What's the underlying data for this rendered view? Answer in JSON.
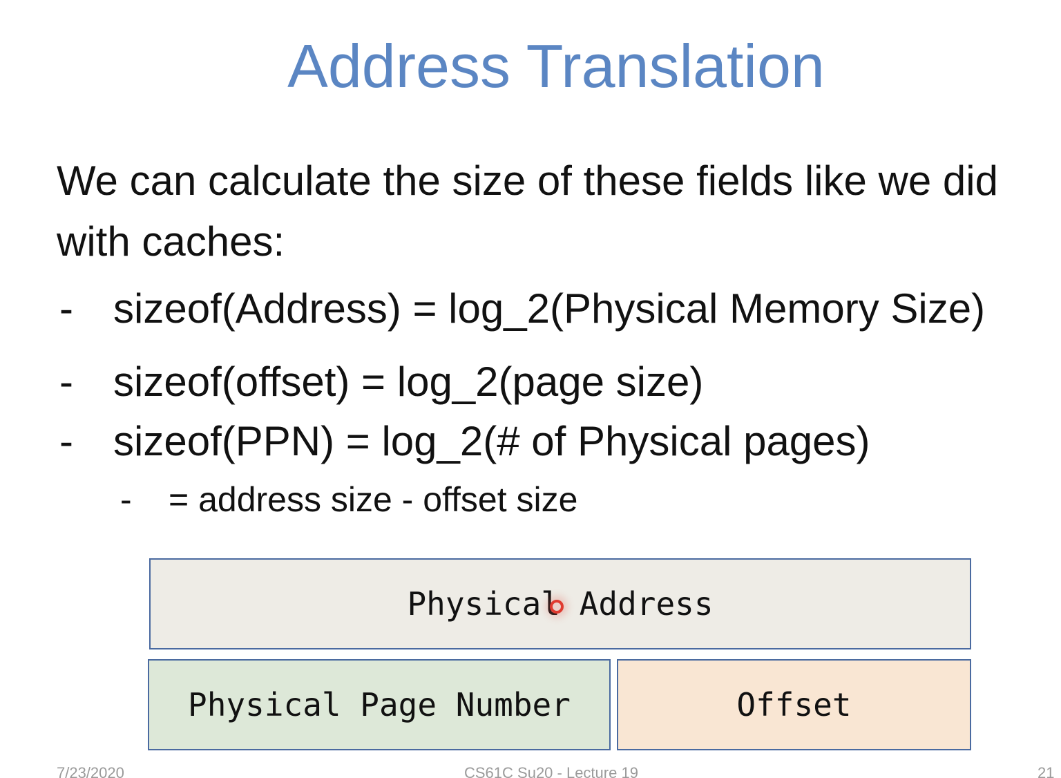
{
  "slide": {
    "title": "Address Translation",
    "intro": "We can calculate the size of these fields like we did with caches:",
    "bullets": [
      {
        "dash": "-",
        "text": "sizeof(Address) = log_2(Physical Memory Size)"
      },
      {
        "dash": "-",
        "text": "sizeof(offset) = log_2(page size)"
      },
      {
        "dash": "-",
        "text": "sizeof(PPN) = log_2(# of Physical pages)"
      }
    ],
    "sub_bullet": {
      "dash": "-",
      "text": "= address size - offset size"
    },
    "diagram": {
      "physical_address": "Physical Address",
      "physical_page_number": "Physical Page Number",
      "offset": "Offset"
    },
    "colors": {
      "title": "#5b86c3",
      "physical_address_fill": "#eeece6",
      "ppn_fill": "#dde8d8",
      "offset_fill": "#f9e6d3",
      "box_border": "#4a6aa0",
      "cursor": "#e03a2f"
    },
    "footer": {
      "date": "7/23/2020",
      "course": "CS61C Su20 - Lecture 19",
      "page": "21"
    }
  }
}
